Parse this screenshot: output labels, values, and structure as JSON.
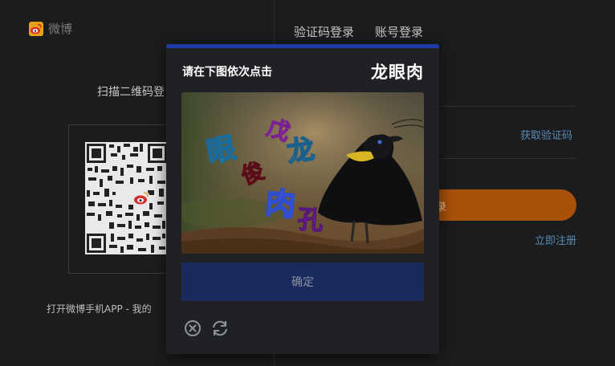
{
  "brand": {
    "name": "微博",
    "icon": "weibo-logo-icon"
  },
  "left": {
    "scan_title": "扫描二维码登",
    "bottom_hint": "打开微博手机APP - 我的"
  },
  "tabs": [
    {
      "label": "验证码登录"
    },
    {
      "label": "账号登录"
    }
  ],
  "right": {
    "get_code": "获取验证码",
    "login_button_partial": "录",
    "register_link": "立即注册"
  },
  "captcha": {
    "prompt": "请在下图依次点击",
    "target_text": "龙眼肉",
    "image_characters": [
      "眼",
      "戊",
      "龙",
      "俊",
      "肉",
      "孔"
    ],
    "confirm_label": "确定",
    "close_icon": "close-circle-icon",
    "refresh_icon": "refresh-icon"
  },
  "colors": {
    "background": "#1b1c1d",
    "modal": "#1f2124",
    "accent_bar": "#1d3aa6",
    "login_button": "#a8510b",
    "link": "#5a8bb6"
  }
}
